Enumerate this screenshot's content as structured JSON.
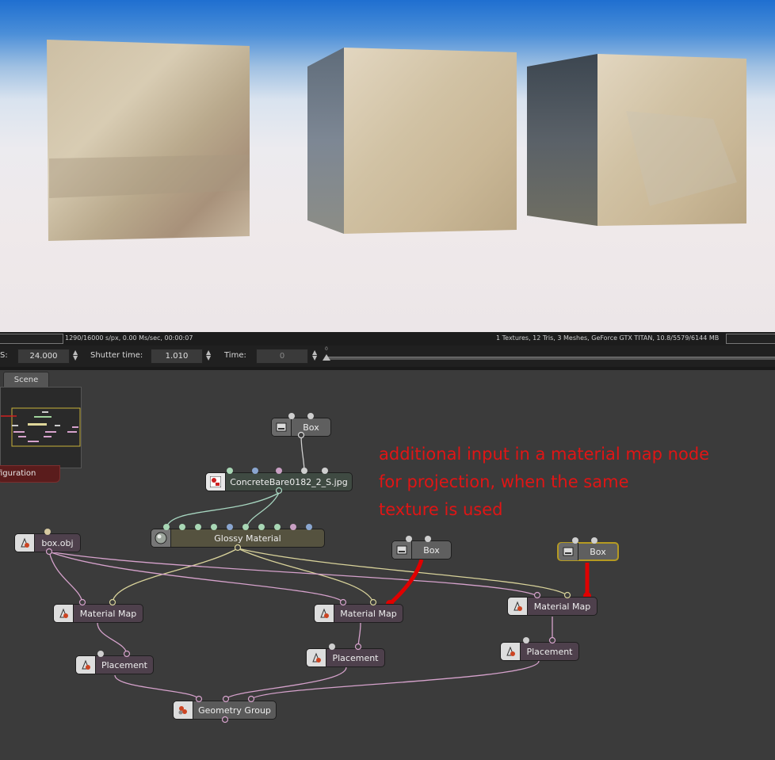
{
  "viewport": {
    "scene": "three textured cubes on gradient sky background"
  },
  "statusbar": {
    "left_text": "1290/16000 s/px, 0.00 Ms/sec, 00:00:07",
    "right_text": "1 Textures, 12 Tris, 3 Meshes, GeForce GTX TITAN, 10.8/5579/6144 MB"
  },
  "controls": {
    "fps_label": "S:",
    "fps_value": "24.000",
    "shutter_label": "Shutter time:",
    "shutter_value": "1.010",
    "time_label": "Time:",
    "time_value": "0",
    "timeline_start": "0"
  },
  "tabs": {
    "scene": "Scene"
  },
  "config_button": "figuration",
  "annotation": "additional input in a material map node\nfor projection, when the same\ntexture is used",
  "nodes": {
    "box_top": "Box",
    "texture": "ConcreteBare0182_2_S.jpg",
    "glossy": "Glossy Material",
    "box_obj": "box.obj",
    "box_mid": "Box",
    "box_right": "Box",
    "matmap_left": "Material Map",
    "matmap_mid": "Material Map",
    "matmap_right": "Material Map",
    "placement_left": "Placement",
    "placement_mid": "Placement",
    "placement_right": "Placement",
    "geometry_group": "Geometry Group"
  },
  "colors": {
    "annotation": "#e01515",
    "selected_node_border": "#b59a22",
    "highlight_wire": "#e00000"
  }
}
